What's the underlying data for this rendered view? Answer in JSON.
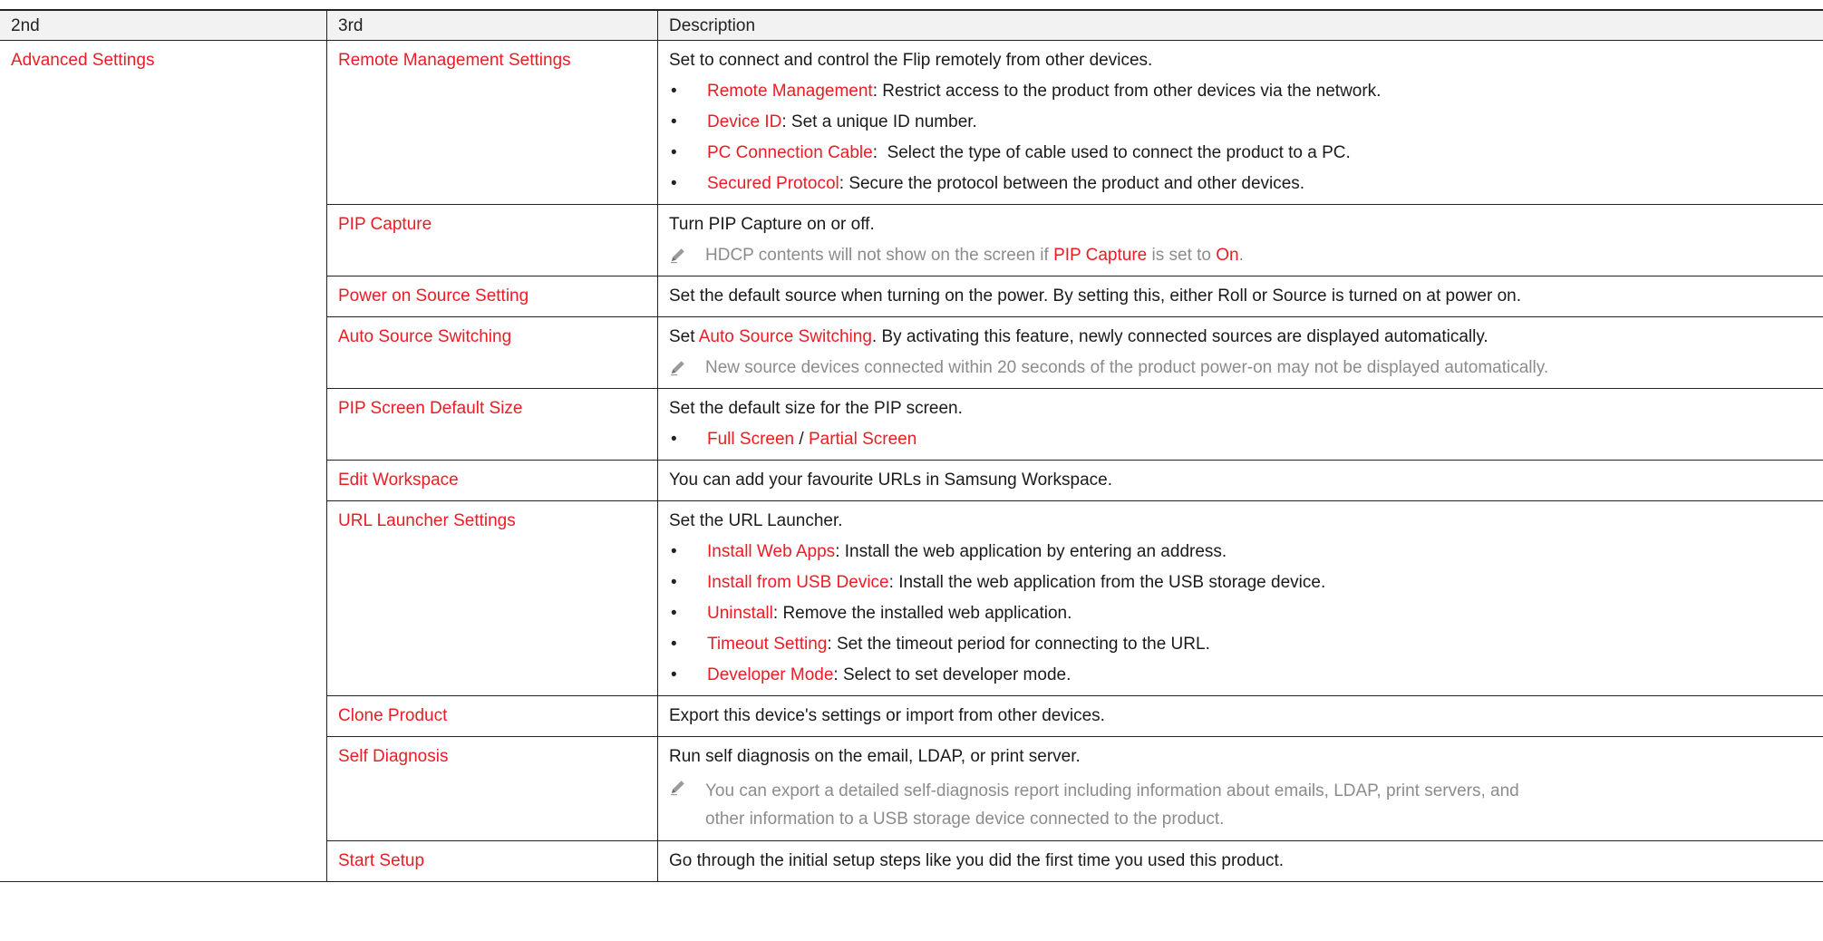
{
  "headers": {
    "c1": "2nd",
    "c2": "3rd",
    "c3": "Description"
  },
  "second_level": "Advanced Settings",
  "rows": [
    {
      "name": "Remote Management Settings",
      "desc": "Set to connect and control the Flip remotely from other devices.",
      "bullets": [
        {
          "term": "Remote Management",
          "sep": ": ",
          "text": "Restrict access to the product from other devices via the network."
        },
        {
          "term": "Device ID",
          "sep": ": ",
          "text": "Set a unique ID number."
        },
        {
          "term": "PC Connection Cable",
          "sep": ":  ",
          "text": "Select the type of cable used to connect the product to a PC."
        },
        {
          "term": "Secured Protocol",
          "sep": ": ",
          "text": "Secure the protocol between the product and other devices."
        }
      ]
    },
    {
      "name": "PIP Capture",
      "desc": "Turn PIP Capture on or off.",
      "note": {
        "a": "HDCP contents will not show on the screen if ",
        "b": "PIP Capture",
        "c": " is set to ",
        "d": "On",
        "e": "."
      }
    },
    {
      "name": "Power on Source Setting",
      "desc": "Set the default source when turning on the power. By setting this, either Roll or Source is turned on at power on."
    },
    {
      "name": "Auto Source Switching",
      "desc_a": "Set ",
      "desc_b": "Auto Source Switching",
      "desc_c": ". By activating this feature, newly connected sources are displayed automatically.",
      "note": "New source devices connected within 20 seconds of the product power-on may not be displayed automatically."
    },
    {
      "name": "PIP Screen Default Size",
      "desc": "Set the default size for the PIP screen.",
      "opt1": "Full Screen",
      "opt_sep": " / ",
      "opt2": "Partial Screen"
    },
    {
      "name": "Edit Workspace",
      "desc": "You can add your favourite URLs in Samsung Workspace."
    },
    {
      "name": "URL Launcher Settings",
      "desc": "Set the URL Launcher.",
      "bullets": [
        {
          "term": "Install Web Apps",
          "sep": ": ",
          "text": "Install the web application by entering an address."
        },
        {
          "term": "Install from USB Device",
          "sep": ": ",
          "text": "Install the web application from the USB storage device."
        },
        {
          "term": "Uninstall",
          "sep": ": ",
          "text": "Remove the installed web application."
        },
        {
          "term": "Timeout Setting",
          "sep": ": ",
          "text": "Set the timeout period for connecting to the URL."
        },
        {
          "term": "Developer Mode",
          "sep": ": ",
          "text": "Select to set developer mode."
        }
      ]
    },
    {
      "name": "Clone Product",
      "desc": "Export this device's settings or import from other devices."
    },
    {
      "name": "Self Diagnosis",
      "desc": "Run self diagnosis on the email, LDAP, or print server.",
      "note": "You can export a detailed self-diagnosis report including information about emails, LDAP, print servers, and other information to a USB storage device connected to the product."
    },
    {
      "name": "Start Setup",
      "desc": "Go through the initial setup steps like you did the first time you used this product."
    }
  ],
  "bullet_char": "•",
  "colors": {
    "accent": "#ec1c24",
    "note": "#8c8c8c",
    "header_bg": "#f2f2f2"
  },
  "icons": {
    "note": "pencil-note-icon"
  }
}
